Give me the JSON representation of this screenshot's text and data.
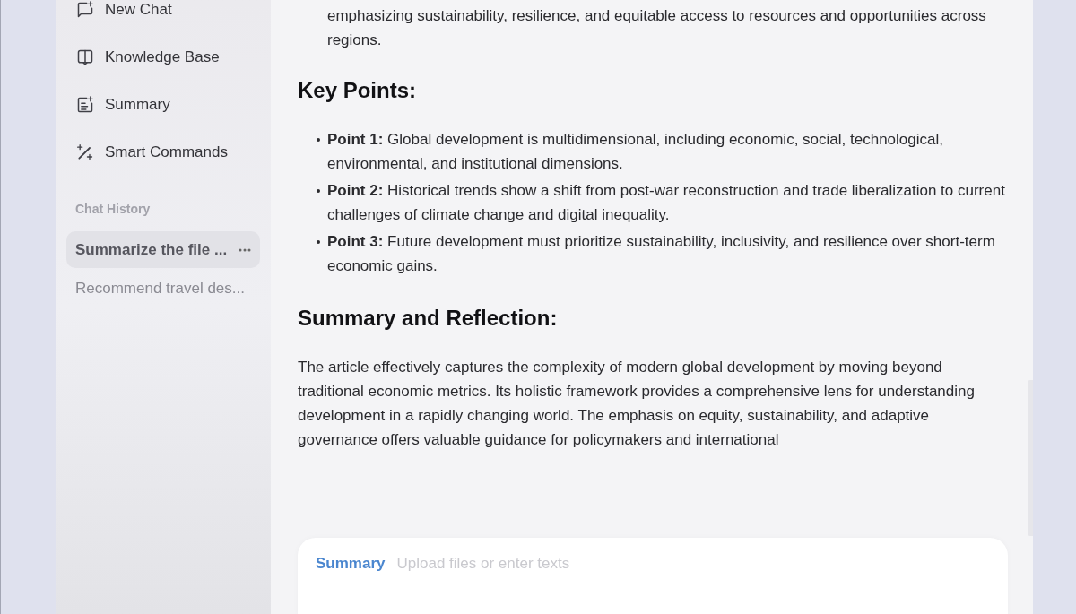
{
  "sidebar": {
    "nav_items": [
      {
        "label": "New Chat"
      },
      {
        "label": "Knowledge Base"
      },
      {
        "label": "Summary"
      },
      {
        "label": "Smart Commands"
      }
    ],
    "history_heading": "Chat History",
    "history": [
      {
        "title": "Summarize the file ...",
        "selected": true
      },
      {
        "title": "Recommend travel des...",
        "selected": false
      }
    ]
  },
  "article": {
    "intro": "emphasizing sustainability, resilience, and equitable access to resources and opportunities across regions.",
    "sections": [
      {
        "heading": "Key Points:",
        "bullets": [
          "**Point 1:** Global development is multidimensional, including economic, social, technological, environmental, and institutional dimensions.",
          "**Point 2:** Historical trends show a shift from post-war reconstruction and trade liberalization to current challenges of climate change and digital inequality.",
          "**Point 3:** Future development must prioritize sustainability, inclusivity, and resilience over short-term economic gains."
        ]
      },
      {
        "heading": "Summary and Reflection:",
        "paragraph": "The article effectively captures the complexity of modern global development by moving beyond traditional economic metrics. Its holistic framework provides a comprehensive lens for understanding development in a rapidly changing world. The emphasis on equity, sustainability, and adaptive governance offers valuable guidance for policymakers and international"
      }
    ]
  },
  "composer": {
    "mode": "Summary",
    "placeholder": "Upload files or enter texts"
  }
}
